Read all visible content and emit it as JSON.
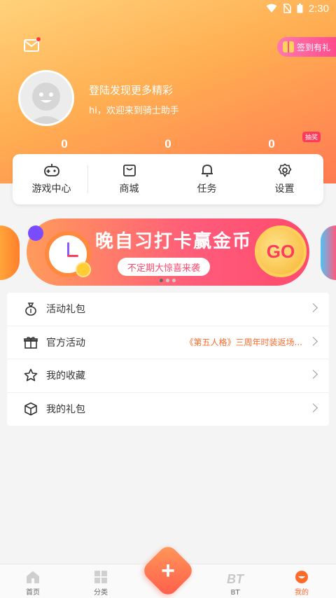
{
  "status": {
    "time": "2:30"
  },
  "header": {
    "checkin_label": "签到有礼",
    "login_title": "登陆发现更多精彩",
    "login_subtitle": "hi，欢迎来到骑士助手",
    "counts": [
      "0",
      "0",
      "0"
    ],
    "lottery_badge": "抽奖"
  },
  "nav": {
    "items": [
      {
        "label": "游戏中心",
        "icon": "gamepad-icon"
      },
      {
        "label": "商城",
        "icon": "shopping-bag-icon"
      },
      {
        "label": "任务",
        "icon": "bell-icon"
      },
      {
        "label": "设置",
        "icon": "gear-icon"
      }
    ]
  },
  "banner": {
    "title": "晚自习打卡赢金币",
    "pill": "不定期大惊喜来袭",
    "go": "GO",
    "dots": 3,
    "active_dot": 0
  },
  "menu": {
    "items": [
      {
        "label": "活动礼包",
        "icon": "money-bag-icon",
        "extra": ""
      },
      {
        "label": "官方活动",
        "icon": "gift-icon",
        "extra": "《第五人格》三周年时装返场..."
      },
      {
        "label": "我的收藏",
        "icon": "star-icon",
        "extra": ""
      },
      {
        "label": "我的礼包",
        "icon": "box-icon",
        "extra": ""
      }
    ]
  },
  "tabbar": {
    "items": [
      {
        "label": "首页",
        "icon": "home-icon"
      },
      {
        "label": "分类",
        "icon": "grid-icon"
      },
      {
        "label": "BT",
        "icon": "bt-icon"
      },
      {
        "label": "我的",
        "icon": "profile-icon"
      }
    ],
    "active": "我的",
    "fab": "+"
  },
  "colors": {
    "accent": "#ff6a2b",
    "header_top": "#ffd27a",
    "header_bottom": "#ff7a52"
  }
}
